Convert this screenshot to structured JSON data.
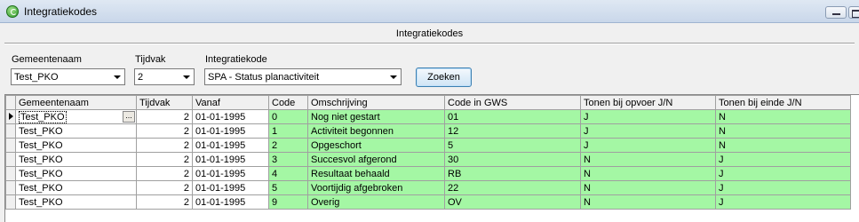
{
  "window": {
    "title": "Integratiekodes"
  },
  "heading": "Integratiekodes",
  "filters": {
    "gemeentenaam": {
      "label": "Gemeentenaam",
      "value": "Test_PKO"
    },
    "tijdvak": {
      "label": "Tijdvak",
      "value": "2"
    },
    "integratiekode": {
      "label": "Integratiekode",
      "value": "SPA - Status planactiviteit"
    },
    "search_label": "Zoeken"
  },
  "grid": {
    "columns": [
      "Gemeentenaam",
      "Tijdvak",
      "Vanaf",
      "Code",
      "Omschrijving",
      "Code in GWS",
      "Tonen bij opvoer J/N",
      "Tonen bij einde J/N"
    ],
    "ellipsis": "...",
    "rows": [
      [
        "Test_PKO",
        "2",
        "01-01-1995",
        "0",
        "Nog niet gestart",
        "01",
        "J",
        "N"
      ],
      [
        "Test_PKO",
        "2",
        "01-01-1995",
        "1",
        "Activiteit begonnen",
        "12",
        "J",
        "N"
      ],
      [
        "Test_PKO",
        "2",
        "01-01-1995",
        "2",
        "Opgeschort",
        "5",
        "J",
        "N"
      ],
      [
        "Test_PKO",
        "2",
        "01-01-1995",
        "3",
        "Succesvol afgerond",
        "30",
        "N",
        "J"
      ],
      [
        "Test_PKO",
        "2",
        "01-01-1995",
        "4",
        "Resultaat behaald",
        "RB",
        "N",
        "J"
      ],
      [
        "Test_PKO",
        "2",
        "01-01-1995",
        "5",
        "Voortijdig afgebroken",
        "22",
        "N",
        "J"
      ],
      [
        "Test_PKO",
        "2",
        "01-01-1995",
        "9",
        "Overig",
        "OV",
        "N",
        "J"
      ]
    ]
  },
  "colors": {
    "editable_cell": "#a4f7a4"
  }
}
